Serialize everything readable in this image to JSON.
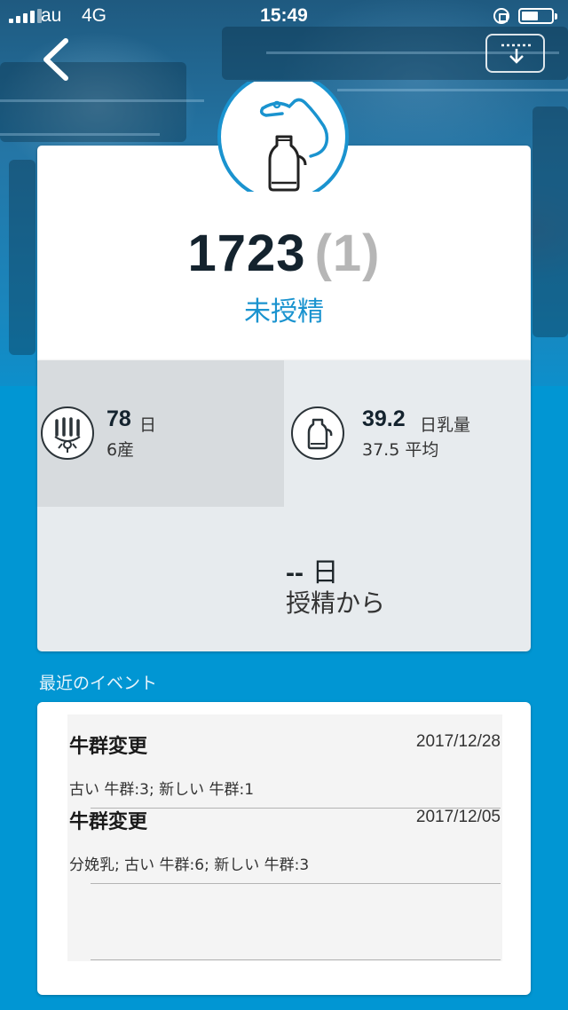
{
  "status_bar": {
    "carrier": "au",
    "network": "4G",
    "time": "15:49",
    "battery_level": 0.55
  },
  "header": {
    "back_icon": "chevron-left-icon",
    "download_icon": "download-icon"
  },
  "cow": {
    "id": "1723",
    "lactation": "(1)",
    "status": "未授精",
    "accent_color": "#1a93cf"
  },
  "stats": {
    "days_in_milk": {
      "value": "78",
      "unit": "日",
      "sub": "6産",
      "icon": "udder-icon"
    },
    "milk": {
      "value": "39.2",
      "unit": "日乳量",
      "sub": "37.5 平均",
      "icon": "milk-can-icon"
    },
    "since_insemination": {
      "value": "--",
      "unit": "日",
      "caption": "授精から"
    }
  },
  "events": {
    "title": "最近のイベント",
    "items": [
      {
        "title": "牛群変更",
        "date": "2017/12/28",
        "description": "古い 牛群:3; 新しい 牛群:1"
      },
      {
        "title": "牛群変更",
        "date": "2017/12/05",
        "description": "分娩乳; 古い 牛群:6; 新しい 牛群:3"
      }
    ]
  }
}
